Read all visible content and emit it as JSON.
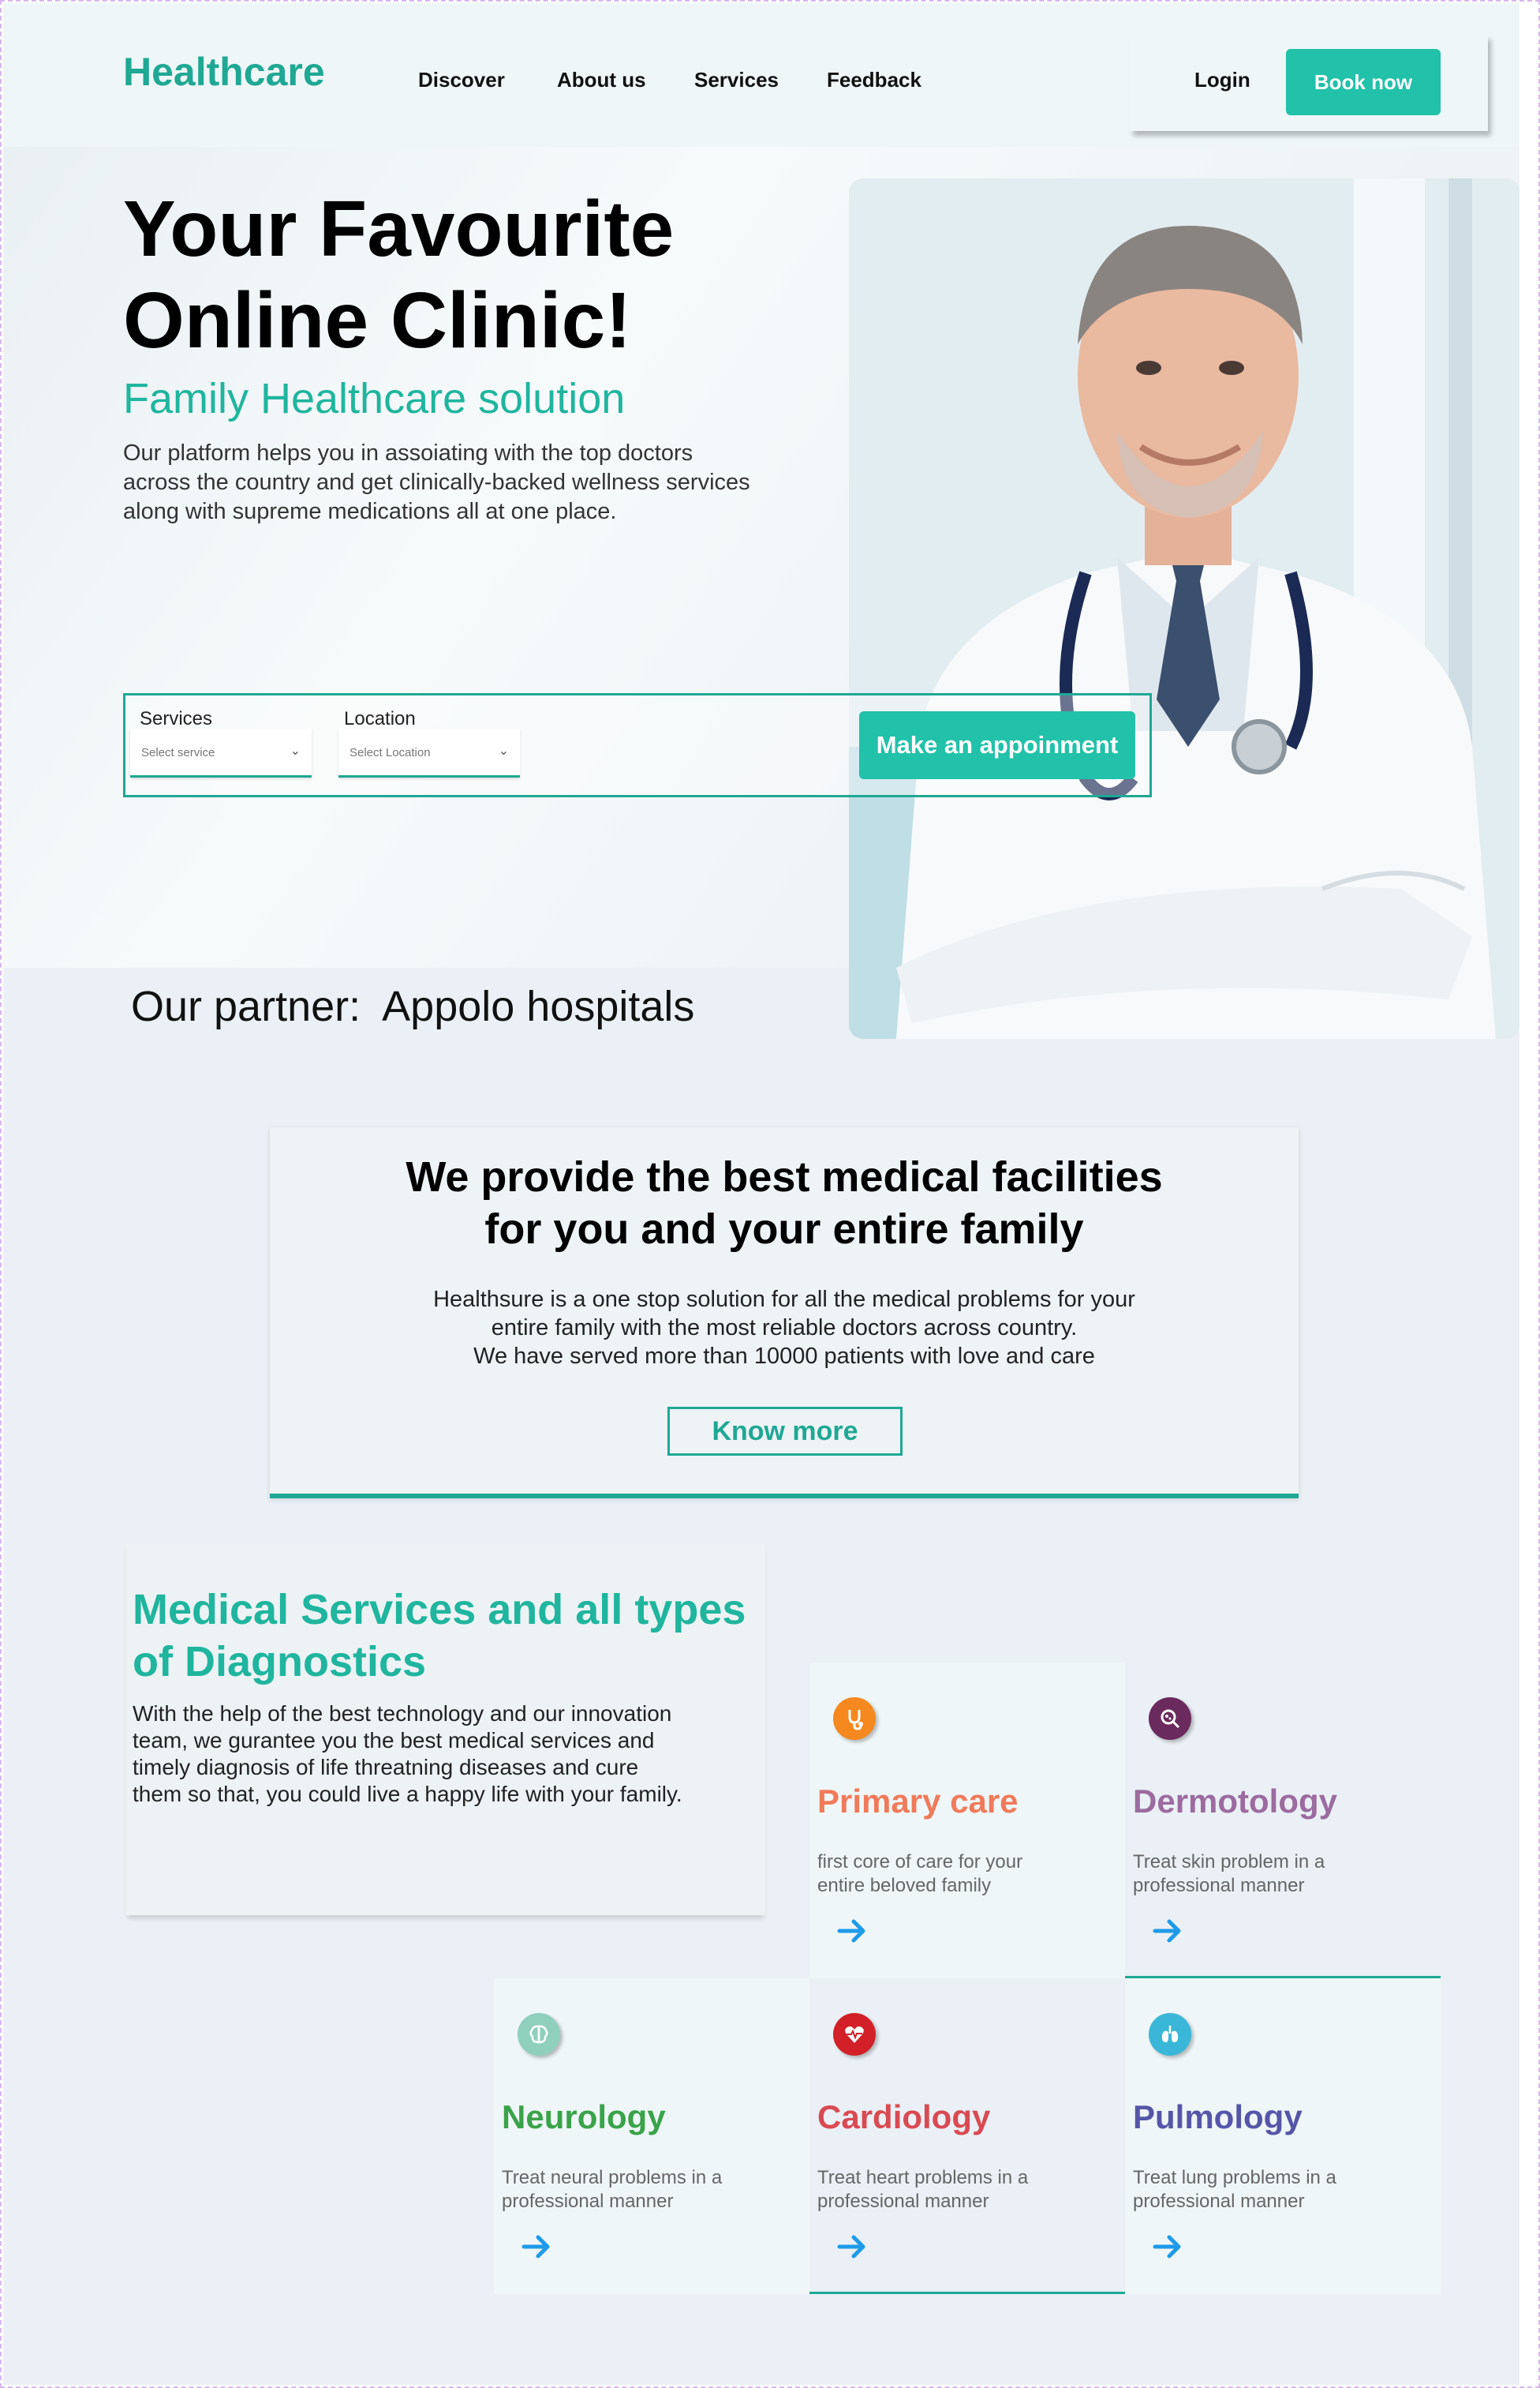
{
  "header": {
    "logo": "Healthcare",
    "nav": [
      "Discover",
      "About us",
      "Services",
      "Feedback"
    ],
    "login": "Login",
    "book_now": "Book now"
  },
  "hero": {
    "title_line1": "Your Favourite",
    "title_line2": "Online Clinic!",
    "subtitle": "Family Healthcare solution",
    "description": "Our platform helps you in assoiating with the top doctors across the country and get clinically-backed wellness services along with supreme medications all at one place."
  },
  "search": {
    "services_label": "Services",
    "services_placeholder": "Select service",
    "location_label": "Location",
    "location_placeholder": "Select  Location",
    "appointment_button": "Make an appoinment"
  },
  "partner": "Our partner:  Appolo hospitals",
  "facilities": {
    "title_line1": "We provide the best medical facilities",
    "title_line2": "for you and your entire family",
    "desc_line1": "Healthsure is a one stop solution for all the medical problems for your",
    "desc_line2": "entire family with the most reliable doctors across country.",
    "desc_line3": "We have served more than 10000 patients with love and care",
    "button": "Know more"
  },
  "medical_services": {
    "title": "Medical Services and all types of Diagnostics",
    "description": "With the help of the best technology and our innovation team, we gurantee you the best medical services and timely diagnosis of life threatning diseases and cure them so that, you could live a happy life with your family."
  },
  "service_cards": [
    {
      "title": "Primary care",
      "desc": "first core of care for your entire beloved family",
      "icon": "stethoscope-icon",
      "color": "#f07a5a",
      "icon_bg": "#f5881f"
    },
    {
      "title": "Dermotology",
      "desc": "Treat skin problem in a professional manner",
      "icon": "skin-magnifier-icon",
      "color": "#9c6ba0",
      "icon_bg": "#6b2a5e"
    },
    {
      "title": "Neurology",
      "desc": "Treat neural problems in a\n professional manner",
      "icon": "brain-icon",
      "color": "#3aa34a",
      "icon_bg": "#8fd0bd"
    },
    {
      "title": "Cardiology",
      "desc": "Treat heart problems in a professional manner",
      "icon": "heart-pulse-icon",
      "color": "#d94a52",
      "icon_bg": "#d32028"
    },
    {
      "title": "Pulmology",
      "desc": "Treat lung problems in a professional manner",
      "icon": "lungs-icon",
      "color": "#5556a8",
      "icon_bg": "#3ab7d8"
    }
  ],
  "colors": {
    "brand": "#1fa894",
    "button": "#22c1aa",
    "arrow": "#1e9be8"
  }
}
